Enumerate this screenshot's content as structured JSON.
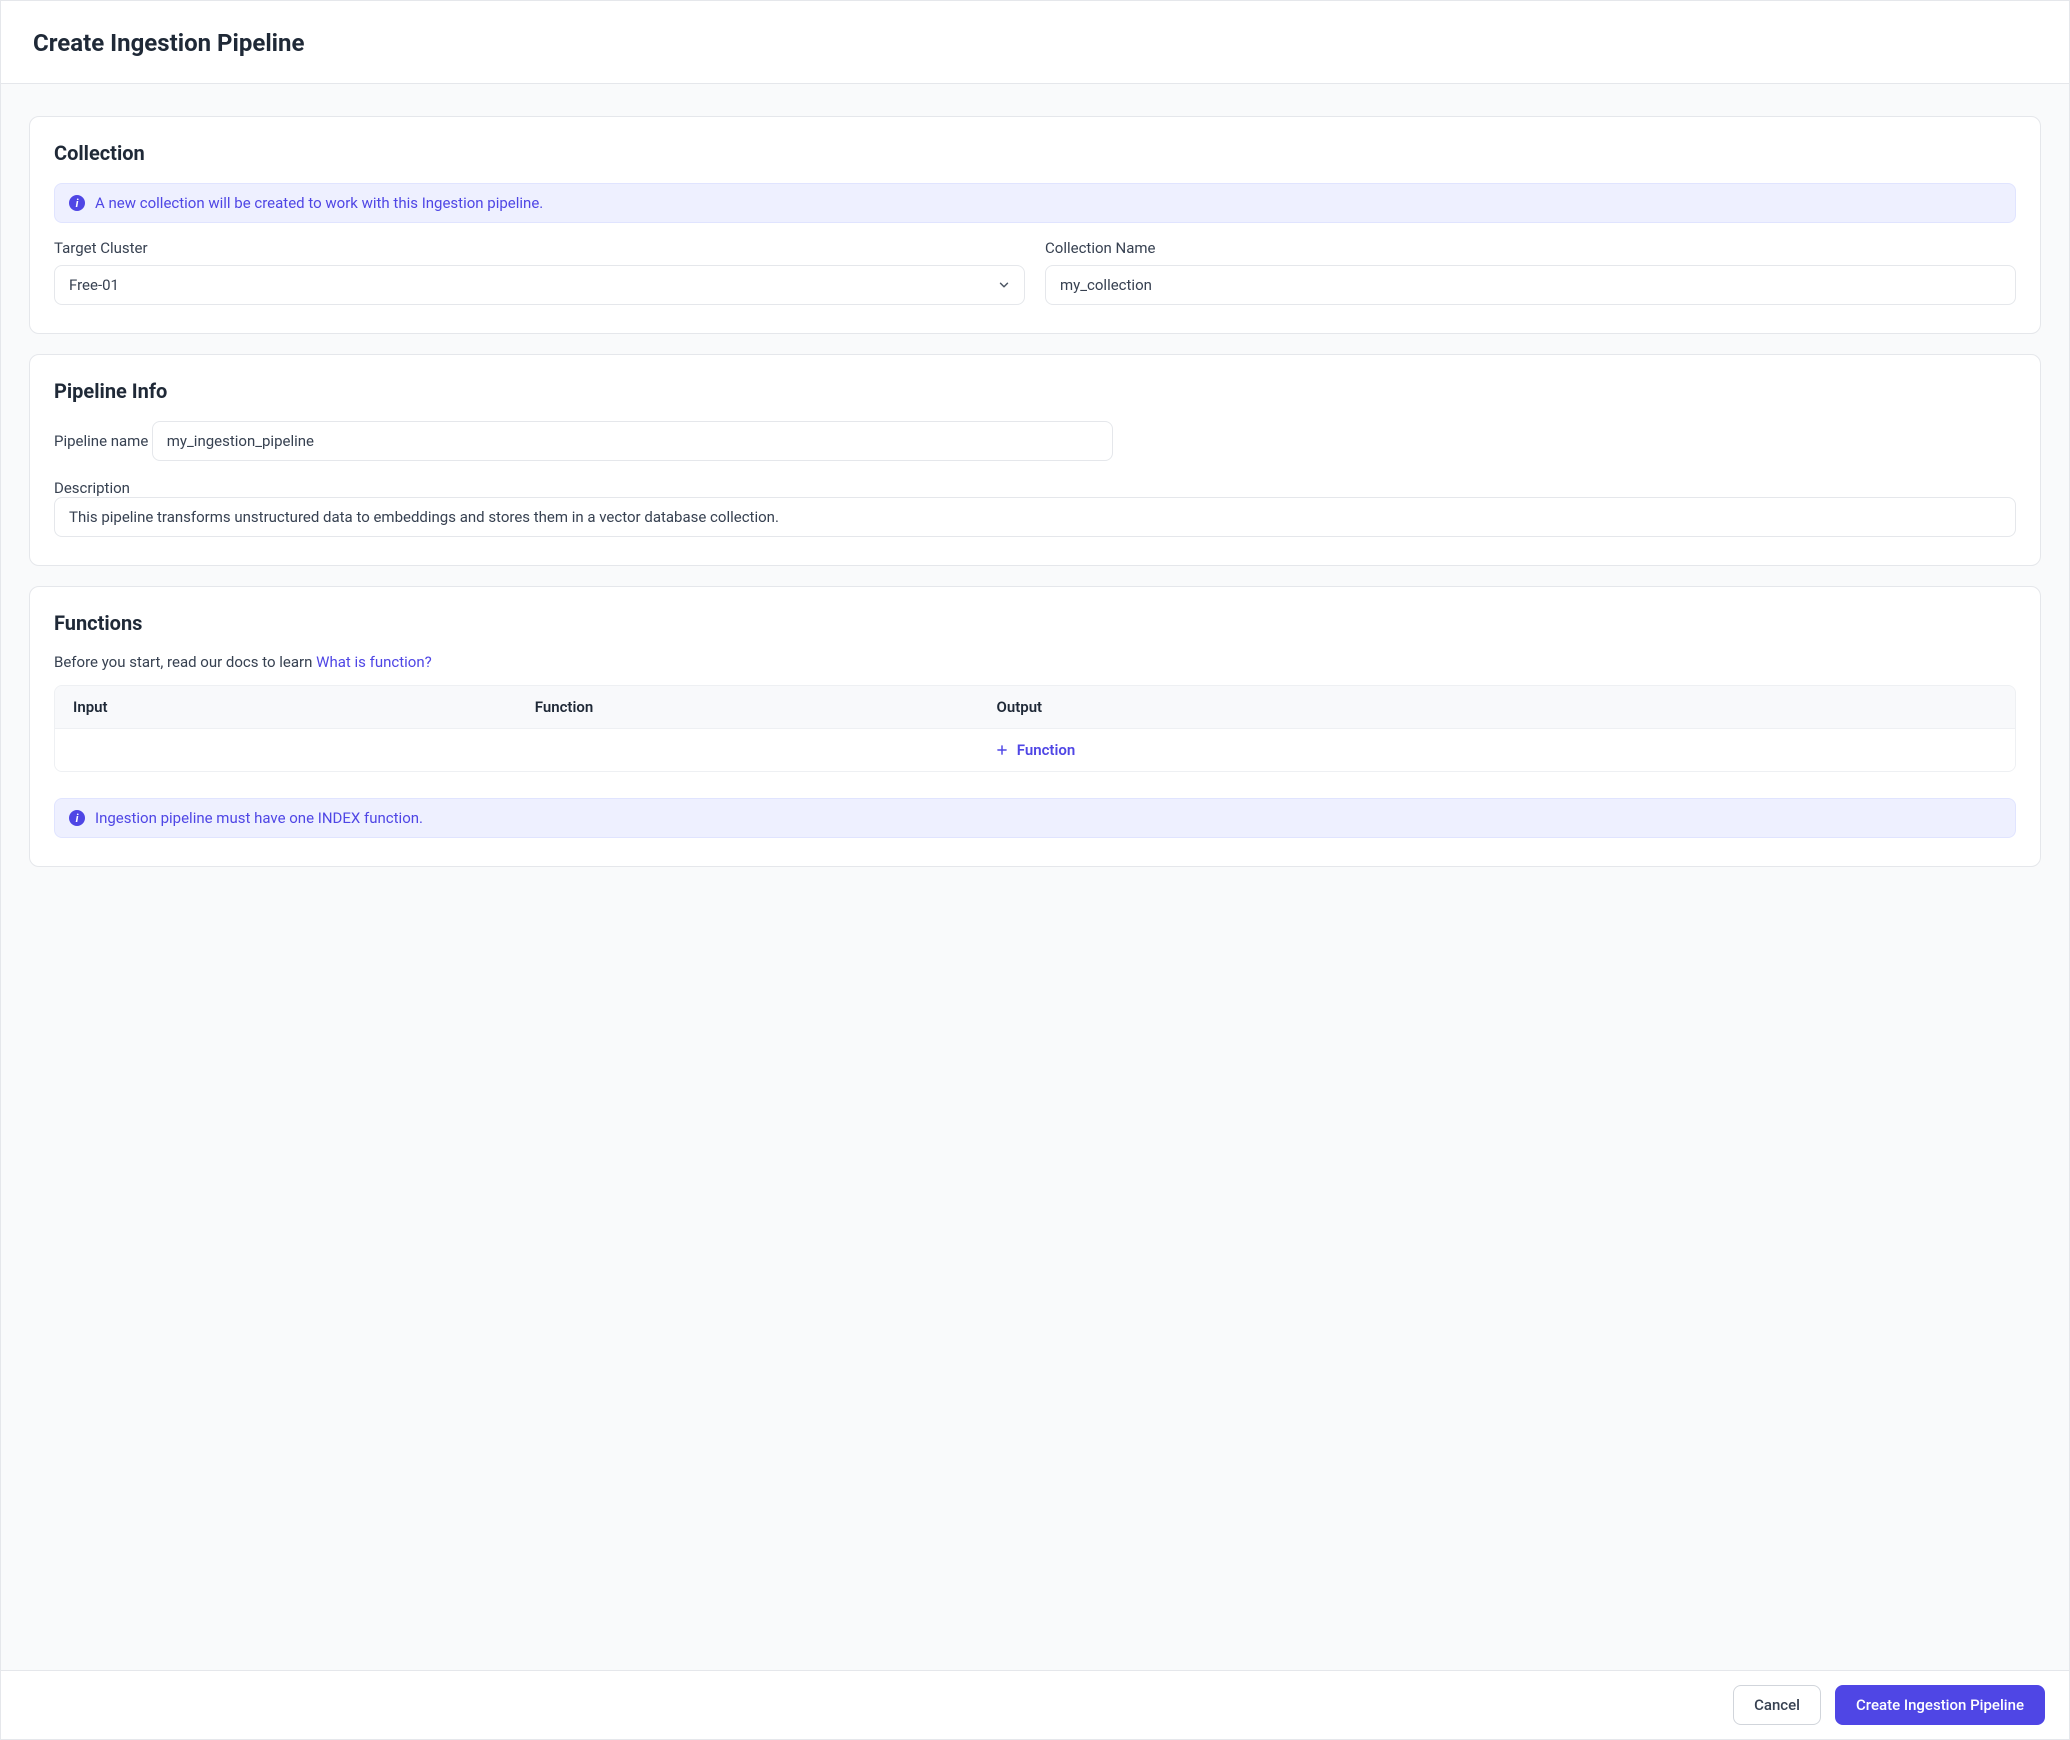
{
  "header": {
    "title": "Create Ingestion Pipeline"
  },
  "collection": {
    "section_title": "Collection",
    "banner_text": "A new collection will be created to work with this Ingestion pipeline.",
    "target_cluster_label": "Target Cluster",
    "target_cluster_value": "Free-01",
    "collection_name_label": "Collection Name",
    "collection_name_value": "my_collection"
  },
  "pipeline_info": {
    "section_title": "Pipeline Info",
    "name_label": "Pipeline name",
    "name_value": "my_ingestion_pipeline",
    "description_label": "Description",
    "description_value": "This pipeline transforms unstructured data to embeddings and stores them in a vector database collection."
  },
  "functions": {
    "section_title": "Functions",
    "hint_prefix": "Before you start, read our docs to learn ",
    "hint_link": "What is function?",
    "table_headers": {
      "input": "Input",
      "function": "Function",
      "output": "Output"
    },
    "add_label": "Function",
    "warn_banner": "Ingestion pipeline must have one INDEX function."
  },
  "footer": {
    "cancel": "Cancel",
    "submit": "Create Ingestion Pipeline"
  }
}
